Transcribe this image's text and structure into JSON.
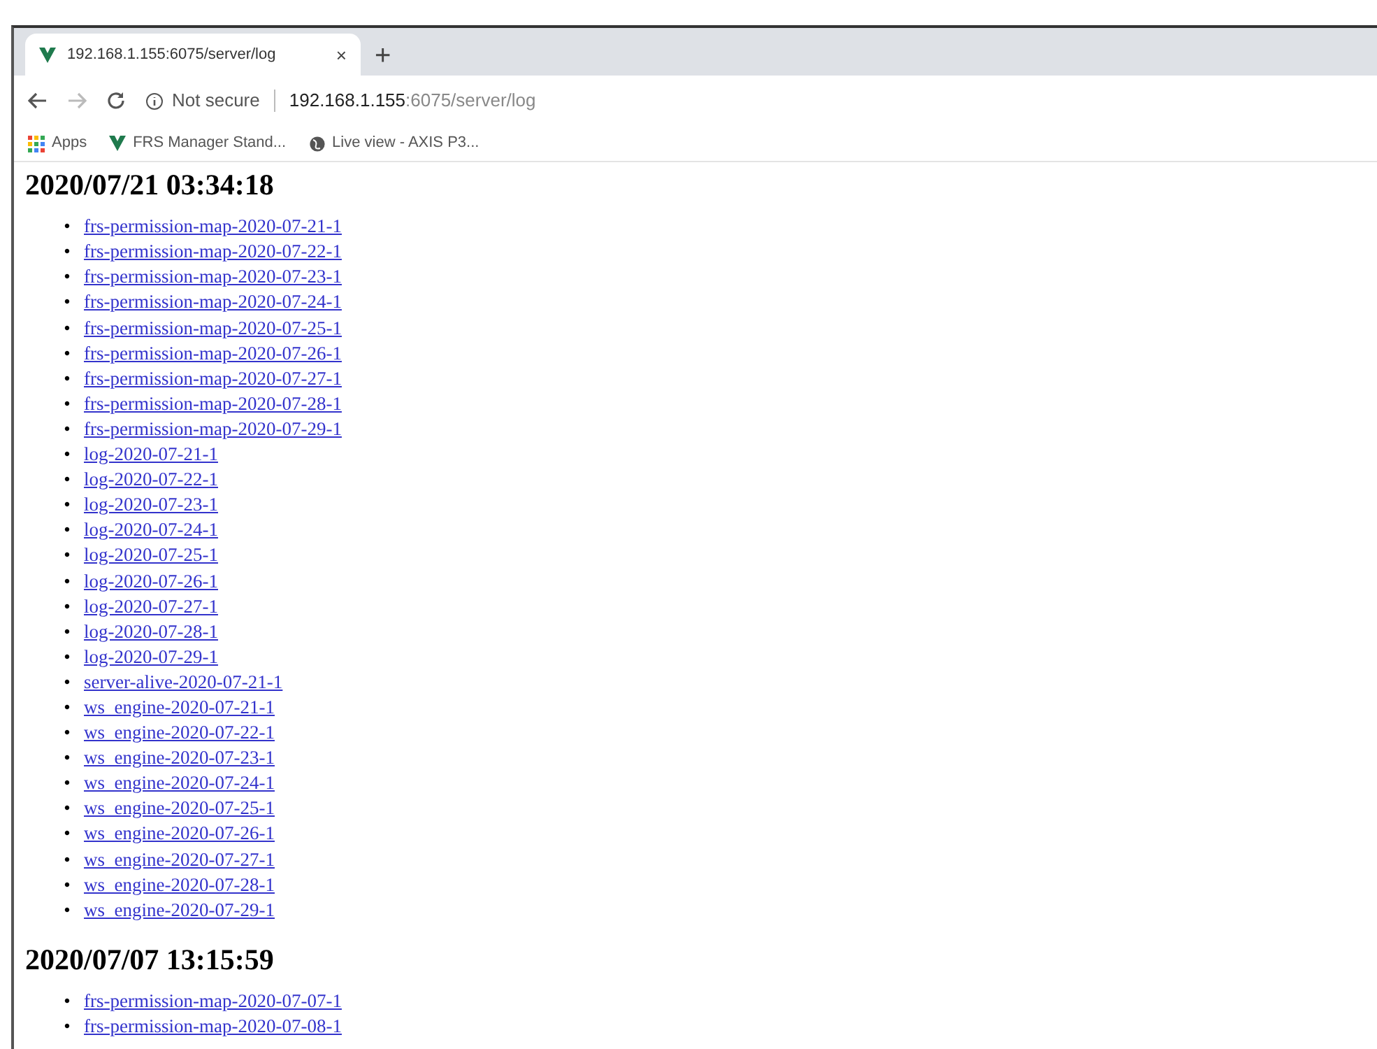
{
  "tab": {
    "title": "192.168.1.155:6075/server/log",
    "close": "×",
    "new_tab": "+"
  },
  "address_bar": {
    "security": "Not secure",
    "host": "192.168.1.155",
    "path": ":6075/server/log"
  },
  "bookmarks": [
    {
      "kind": "apps",
      "label": "Apps"
    },
    {
      "kind": "site",
      "label": "FRS Manager Stand..."
    },
    {
      "kind": "globe",
      "label": "Live view - AXIS P3..."
    }
  ],
  "sections": [
    {
      "heading": "2020/07/21 03:34:18",
      "links": [
        {
          "bullet": "•",
          "text": "frs-permission-map-2020-07-21-1"
        },
        {
          "bullet": "•",
          "text": "frs-permission-map-2020-07-22-1"
        },
        {
          "bullet": "•",
          "text": "frs-permission-map-2020-07-23-1"
        },
        {
          "bullet": "•",
          "text": "frs-permission-map-2020-07-24-1"
        },
        {
          "bullet": "•",
          "text": "frs-permission-map-2020-07-25-1"
        },
        {
          "bullet": "•",
          "text": "frs-permission-map-2020-07-26-1"
        },
        {
          "bullet": "•",
          "text": "frs-permission-map-2020-07-27-1"
        },
        {
          "bullet": "•",
          "text": "frs-permission-map-2020-07-28-1"
        },
        {
          "bullet": "•",
          "text": "frs-permission-map-2020-07-29-1"
        },
        {
          "bullet": "•",
          "text": "log-2020-07-21-1"
        },
        {
          "bullet": "•",
          "text": "log-2020-07-22-1"
        },
        {
          "bullet": "•",
          "text": "log-2020-07-23-1"
        },
        {
          "bullet": "•",
          "text": "log-2020-07-24-1"
        },
        {
          "bullet": "•",
          "text": "log-2020-07-25-1"
        },
        {
          "bullet": "•",
          "text": "log-2020-07-26-1"
        },
        {
          "bullet": "•",
          "text": "log-2020-07-27-1"
        },
        {
          "bullet": "•",
          "text": "log-2020-07-28-1"
        },
        {
          "bullet": "•",
          "text": "log-2020-07-29-1"
        },
        {
          "bullet": "•",
          "text": "server-alive-2020-07-21-1"
        },
        {
          "bullet": "•",
          "text": "ws_engine-2020-07-21-1"
        },
        {
          "bullet": "•",
          "text": "ws_engine-2020-07-22-1"
        },
        {
          "bullet": "•",
          "text": "ws_engine-2020-07-23-1"
        },
        {
          "bullet": "•",
          "text": "ws_engine-2020-07-24-1"
        },
        {
          "bullet": "•",
          "text": "ws_engine-2020-07-25-1"
        },
        {
          "bullet": "•",
          "text": "ws_engine-2020-07-26-1"
        },
        {
          "bullet": "•",
          "text": "ws_engine-2020-07-27-1"
        },
        {
          "bullet": "•",
          "text": "ws_engine-2020-07-28-1"
        },
        {
          "bullet": "•",
          "text": "ws_engine-2020-07-29-1"
        }
      ]
    },
    {
      "heading": "2020/07/07 13:15:59",
      "links": [
        {
          "bullet": "•",
          "text": "frs-permission-map-2020-07-07-1"
        },
        {
          "bullet": "•",
          "text": "frs-permission-map-2020-07-08-1"
        }
      ]
    }
  ]
}
